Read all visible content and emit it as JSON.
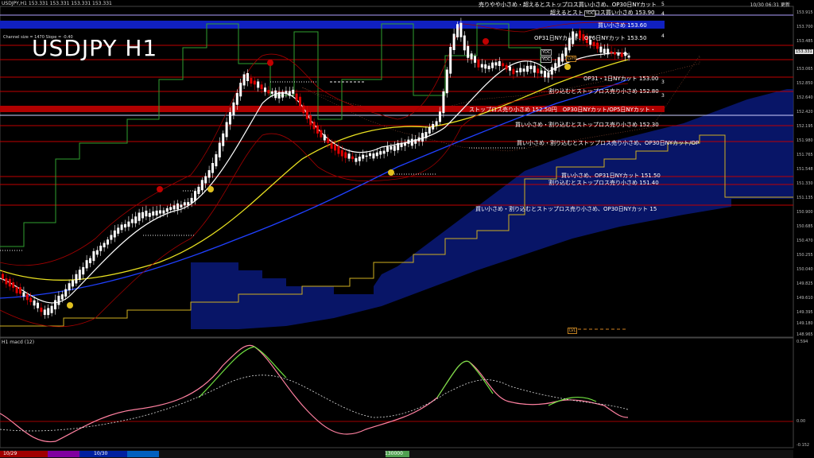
{
  "header": {
    "symbol_line": "USDJPY,H1  153.331 153.331 153.331 153.331",
    "indicator_note": "Channel size = 1470 Slope = -0.40",
    "title": "USDJPY H1",
    "clock": "10/30 06:31 更新"
  },
  "annotations": [
    {
      "text": "売りやや小さめ・超えるとストップロス買い小さめ、OP30日NYカット"
    },
    {
      "text": "超えるとストップロス買い小さめ 153.90"
    },
    {
      "text": "買い小さめ 153.60"
    },
    {
      "text": "OP31日NYカット、OP6日NYカット 153.50"
    },
    {
      "text": "OP31・1日NYカット 153.00"
    },
    {
      "text": "割り込むとストップロス売り小さめ 152.80"
    },
    {
      "text": "ストップロス売り小さめ 152.50円　OP30日NYカット/OP5日NYカット・"
    },
    {
      "text": "買い小さめ・割り込むとストップロス売り小さめ 152.30"
    },
    {
      "text": "買い小さめ・割り込むとストップロス売り小さめ、OP30日NYカット/OP"
    },
    {
      "text": "買い小さめ、OP31日NYカット 151.50"
    },
    {
      "text": "割り込むとストップロス売り小さめ 151.40"
    },
    {
      "text": "買い小さめ・割り込むとストップロス売り小さめ、OP30日NYカット 15"
    }
  ],
  "level_numbers": [
    "5",
    "4",
    "4",
    "3",
    "3"
  ],
  "price_axis": [
    "153.915",
    "153.700",
    "153.485",
    "153.065",
    "152.850",
    "152.640",
    "152.420",
    "152.195",
    "151.980",
    "151.765",
    "151.548",
    "151.330",
    "151.135",
    "150.900",
    "150.685",
    "150.470",
    "150.255",
    "150.040",
    "149.825",
    "149.610",
    "149.395",
    "149.180",
    "148.965"
  ],
  "current_price": "153.331",
  "tags": {
    "ydc1": "YDC",
    "ydc2": "YDC",
    "ydc3": "YDC",
    "lvh": "LVH",
    "lvl": "LVL"
  },
  "macd": {
    "title": "H1  macd (12)",
    "axis": [
      "0.594",
      "0.00",
      "-0.152"
    ]
  },
  "bottom_bar": {
    "date1": "10/29",
    "date2": "10/30",
    "badge": "130000"
  },
  "colors": {
    "bg": "#000000",
    "bull": "#ffffff",
    "bear": "#e00000",
    "accent_blue": "#1020c0",
    "accent_red": "#b00000",
    "ma_white": "#ffffff",
    "ma_yellow": "#e8e020",
    "ma_blue": "#2040ff",
    "macd_main": "#70e040",
    "macd_signal": "#dddddd"
  }
}
